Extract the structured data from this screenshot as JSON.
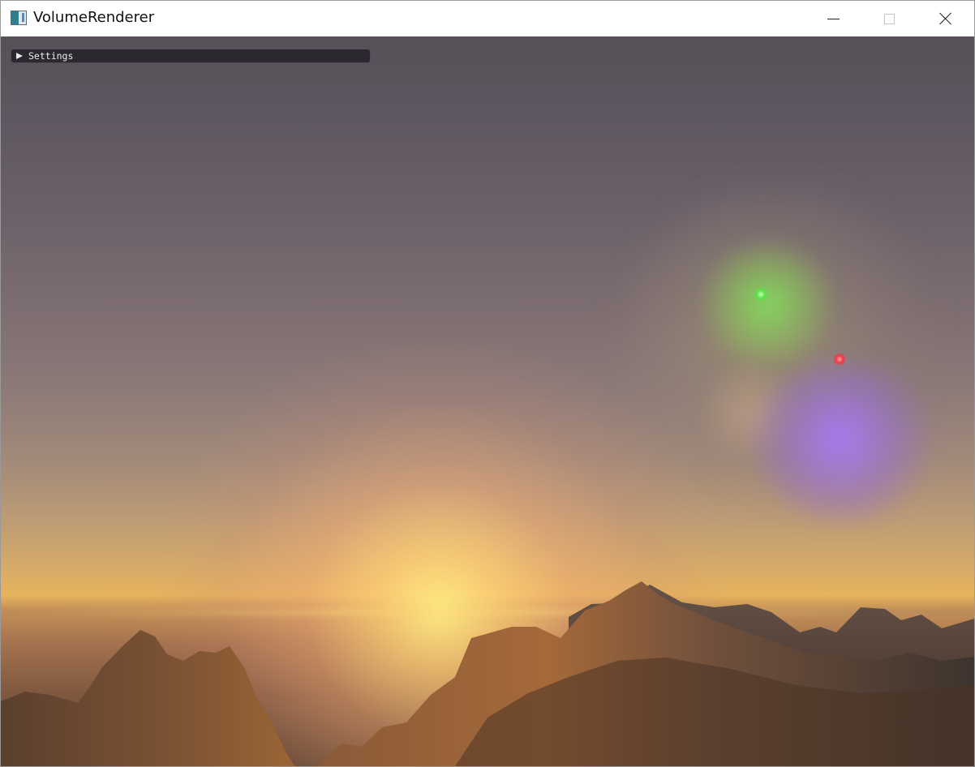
{
  "window": {
    "title": "VolumeRenderer",
    "controls": {
      "minimize": "minimize-icon",
      "maximize": "maximize-icon",
      "close": "close-icon"
    }
  },
  "overlay": {
    "settings_header": {
      "label": "Settings",
      "state": "collapsed",
      "icon": "triangle-right-icon"
    }
  },
  "scene": {
    "lights": [
      {
        "color": "#59e34a"
      },
      {
        "color": "#ee3a46"
      }
    ],
    "volume_colors": [
      "#82e65a",
      "#aa78ff"
    ],
    "sky_top_color": "#585058",
    "sun_color": "#ffe882"
  }
}
